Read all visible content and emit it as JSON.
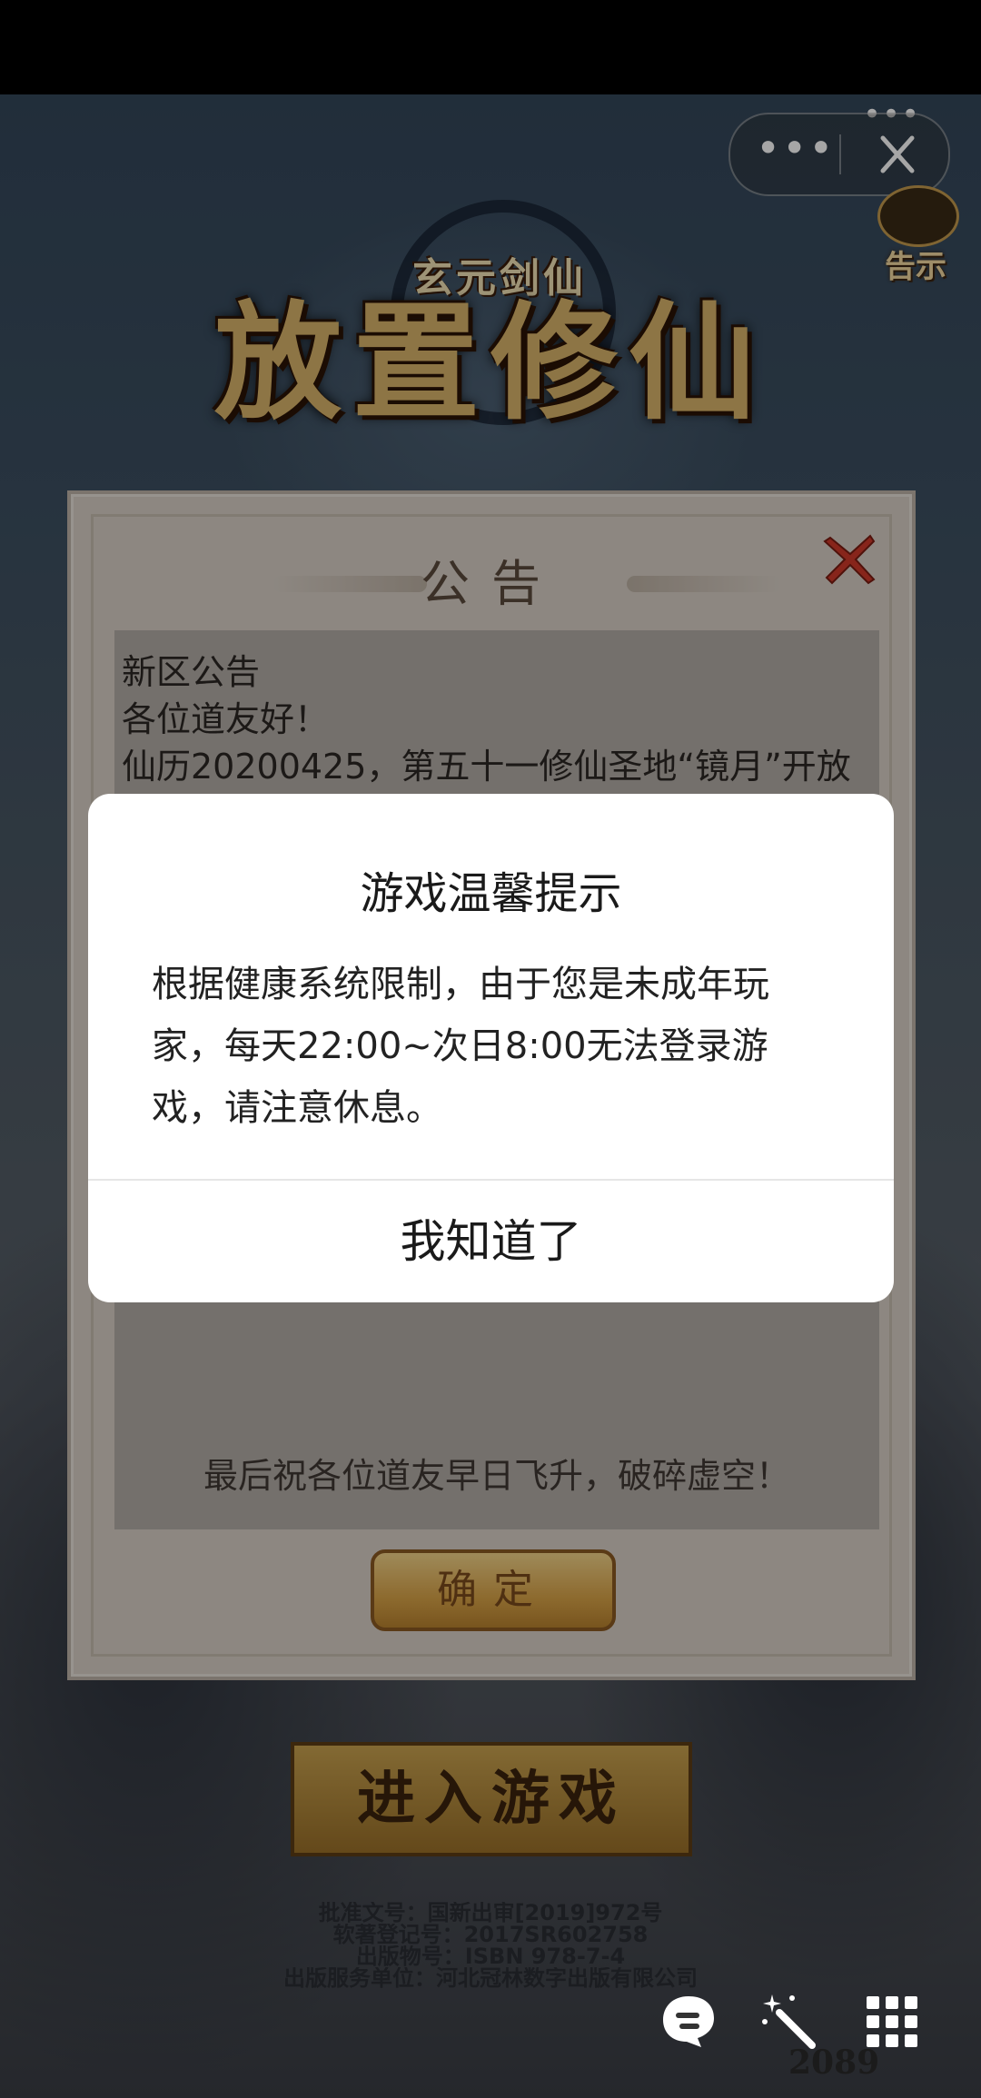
{
  "capsule": {
    "more_glyph": "•••",
    "close_glyph": "✕"
  },
  "top_dots": "•••",
  "notice_badge": {
    "label": "告示"
  },
  "logo": {
    "small": "玄元剑仙",
    "big": "放置修仙"
  },
  "announcement": {
    "title": "公告",
    "lines": [
      "新区公告",
      "各位道友好！",
      "仙历20200425，第五十一修仙圣地“镜月”开放"
    ],
    "closing": "最后祝各位道友早日飞升，破碎虚空！",
    "confirm_label": "确定"
  },
  "enter_button": "进入游戏",
  "legal": [
    "批准文号：国新出审[2019]972号",
    "软著登记号：2017SR602758",
    "出版物号：ISBN 978-7-4",
    "出版服务单位：河北冠林数字出版有限公司"
  ],
  "counter": "2089",
  "modal": {
    "title": "游戏温馨提示",
    "body_lines": [
      "根据健康系统限制，由于您是未成年玩",
      "家，每天22:00~次日8:00无法登录游",
      "戏，请注意休息。"
    ],
    "button_label": "我知道了"
  },
  "colors": {
    "panel_bg": "#d9d0c7",
    "panel_content_bg": "#b3aca6",
    "close_red": "#d03a2a",
    "gold": "#d9b46a",
    "modal_bg": "#ffffff"
  }
}
